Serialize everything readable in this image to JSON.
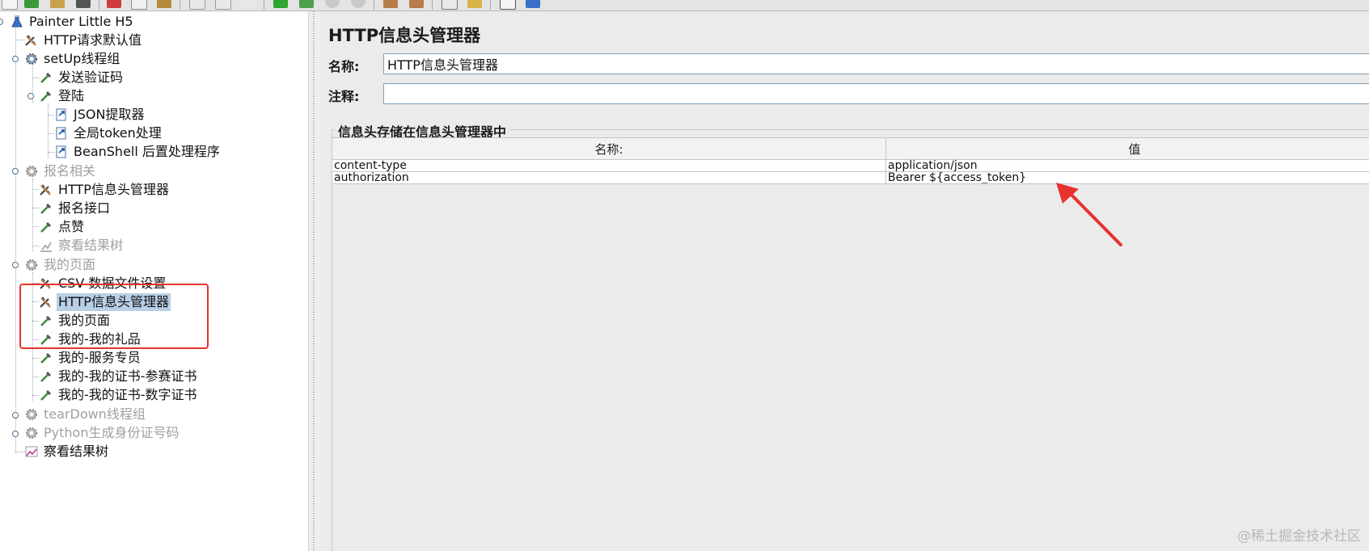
{
  "tree": {
    "root": {
      "label": "Painter Little H5",
      "icon": "testplan-flask-icon"
    },
    "items": [
      {
        "label": "HTTP请求默认值",
        "icon": "wrench-icon",
        "disabled": false,
        "selected": false
      },
      {
        "label": "setUp线程组",
        "icon": "gear-icon",
        "disabled": false,
        "selected": false
      },
      {
        "label": "发送验证码",
        "icon": "pipette-sampler-icon",
        "disabled": false,
        "selected": false
      },
      {
        "label": "登陆",
        "icon": "pipette-sampler-icon",
        "disabled": false,
        "selected": false
      },
      {
        "label": "JSON提取器",
        "icon": "doc-arrow-icon",
        "disabled": false,
        "selected": false
      },
      {
        "label": "全局token处理",
        "icon": "doc-arrow-icon",
        "disabled": false,
        "selected": false
      },
      {
        "label": "BeanShell 后置处理程序",
        "icon": "doc-arrow-icon",
        "disabled": false,
        "selected": false
      },
      {
        "label": "报名相关",
        "icon": "gear-icon",
        "disabled": true,
        "selected": false
      },
      {
        "label": "HTTP信息头管理器",
        "icon": "wrench-icon",
        "disabled": false,
        "selected": false
      },
      {
        "label": "报名接口",
        "icon": "pipette-sampler-icon",
        "disabled": false,
        "selected": false
      },
      {
        "label": "点赞",
        "icon": "pipette-sampler-icon",
        "disabled": false,
        "selected": false
      },
      {
        "label": "察看结果树",
        "icon": "chart-icon",
        "disabled": true,
        "selected": false
      },
      {
        "label": "我的页面",
        "icon": "gear-icon",
        "disabled": true,
        "selected": false
      },
      {
        "label": "CSV 数据文件设置",
        "icon": "wrench-icon",
        "disabled": false,
        "selected": false
      },
      {
        "label": "HTTP信息头管理器",
        "icon": "wrench-icon",
        "disabled": false,
        "selected": true
      },
      {
        "label": "我的页面",
        "icon": "pipette-sampler-icon",
        "disabled": false,
        "selected": false
      },
      {
        "label": "我的-我的礼品",
        "icon": "pipette-sampler-icon",
        "disabled": false,
        "selected": false
      },
      {
        "label": "我的-服务专员",
        "icon": "pipette-sampler-icon",
        "disabled": false,
        "selected": false
      },
      {
        "label": "我的-我的证书-参赛证书",
        "icon": "pipette-sampler-icon",
        "disabled": false,
        "selected": false
      },
      {
        "label": "我的-我的证书-数字证书",
        "icon": "pipette-sampler-icon",
        "disabled": false,
        "selected": false
      },
      {
        "label": "tearDown线程组",
        "icon": "gear-icon",
        "disabled": true,
        "selected": false
      },
      {
        "label": "Python生成身份证号码",
        "icon": "gear-icon",
        "disabled": true,
        "selected": false
      },
      {
        "label": "察看结果树",
        "icon": "chart-icon",
        "disabled": false,
        "selected": false
      }
    ]
  },
  "panel": {
    "title": "HTTP信息头管理器",
    "name_label": "名称:",
    "name_value": "HTTP信息头管理器",
    "comment_label": "注释:",
    "comment_value": "",
    "group_title": "信息头存储在信息头管理器中",
    "table": {
      "columns": [
        "名称:",
        "值"
      ],
      "rows": [
        [
          "content-type",
          "application/json"
        ],
        [
          "authorization",
          "Bearer ${access_token}"
        ]
      ]
    }
  },
  "annotations": {
    "highlight_color": "#e8322e",
    "arrow_color": "#e8322e"
  },
  "watermark": "@稀土掘金技术社区"
}
